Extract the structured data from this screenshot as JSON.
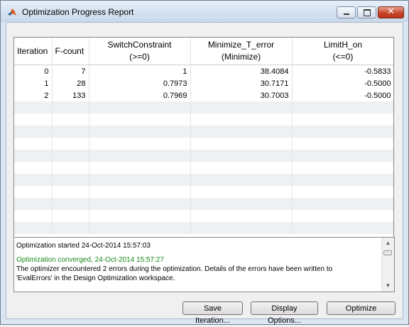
{
  "window": {
    "title": "Optimization Progress Report",
    "close_glyph": "✕"
  },
  "table": {
    "columns": [
      {
        "line1": "Iteration",
        "line2": ""
      },
      {
        "line1": "F-count",
        "line2": ""
      },
      {
        "line1": "SwitchConstraint",
        "line2": "(>=0)"
      },
      {
        "line1": "Minimize_T_error",
        "line2": "(Minimize)"
      },
      {
        "line1": "LimitH_on",
        "line2": "(<=0)"
      }
    ],
    "rows": [
      [
        "0",
        "7",
        "1",
        "38.4084",
        "-0.5833"
      ],
      [
        "1",
        "28",
        "0.7973",
        "30.7171",
        "-0.5000"
      ],
      [
        "2",
        "133",
        "0.7969",
        "30.7003",
        "-0.5000"
      ]
    ]
  },
  "log": {
    "line1": "Optimization started 24-Oct-2014 15:57:03",
    "line2": "Optimization converged, 24-Oct-2014 15:57:27",
    "line3": "The optimizer encountered 2 errors during the optimization. Details of the errors have been written to",
    "line4": "'EvalErrors' in the Design Optimization workspace.",
    "green_color": "#19891c"
  },
  "buttons": {
    "save_iteration": "Save Iteration...",
    "display_options": "Display Options...",
    "optimize": "Optimize"
  },
  "icons": {
    "app": "matlab-logo-icon",
    "scroll_up": "▲",
    "scroll_down": "▼"
  }
}
